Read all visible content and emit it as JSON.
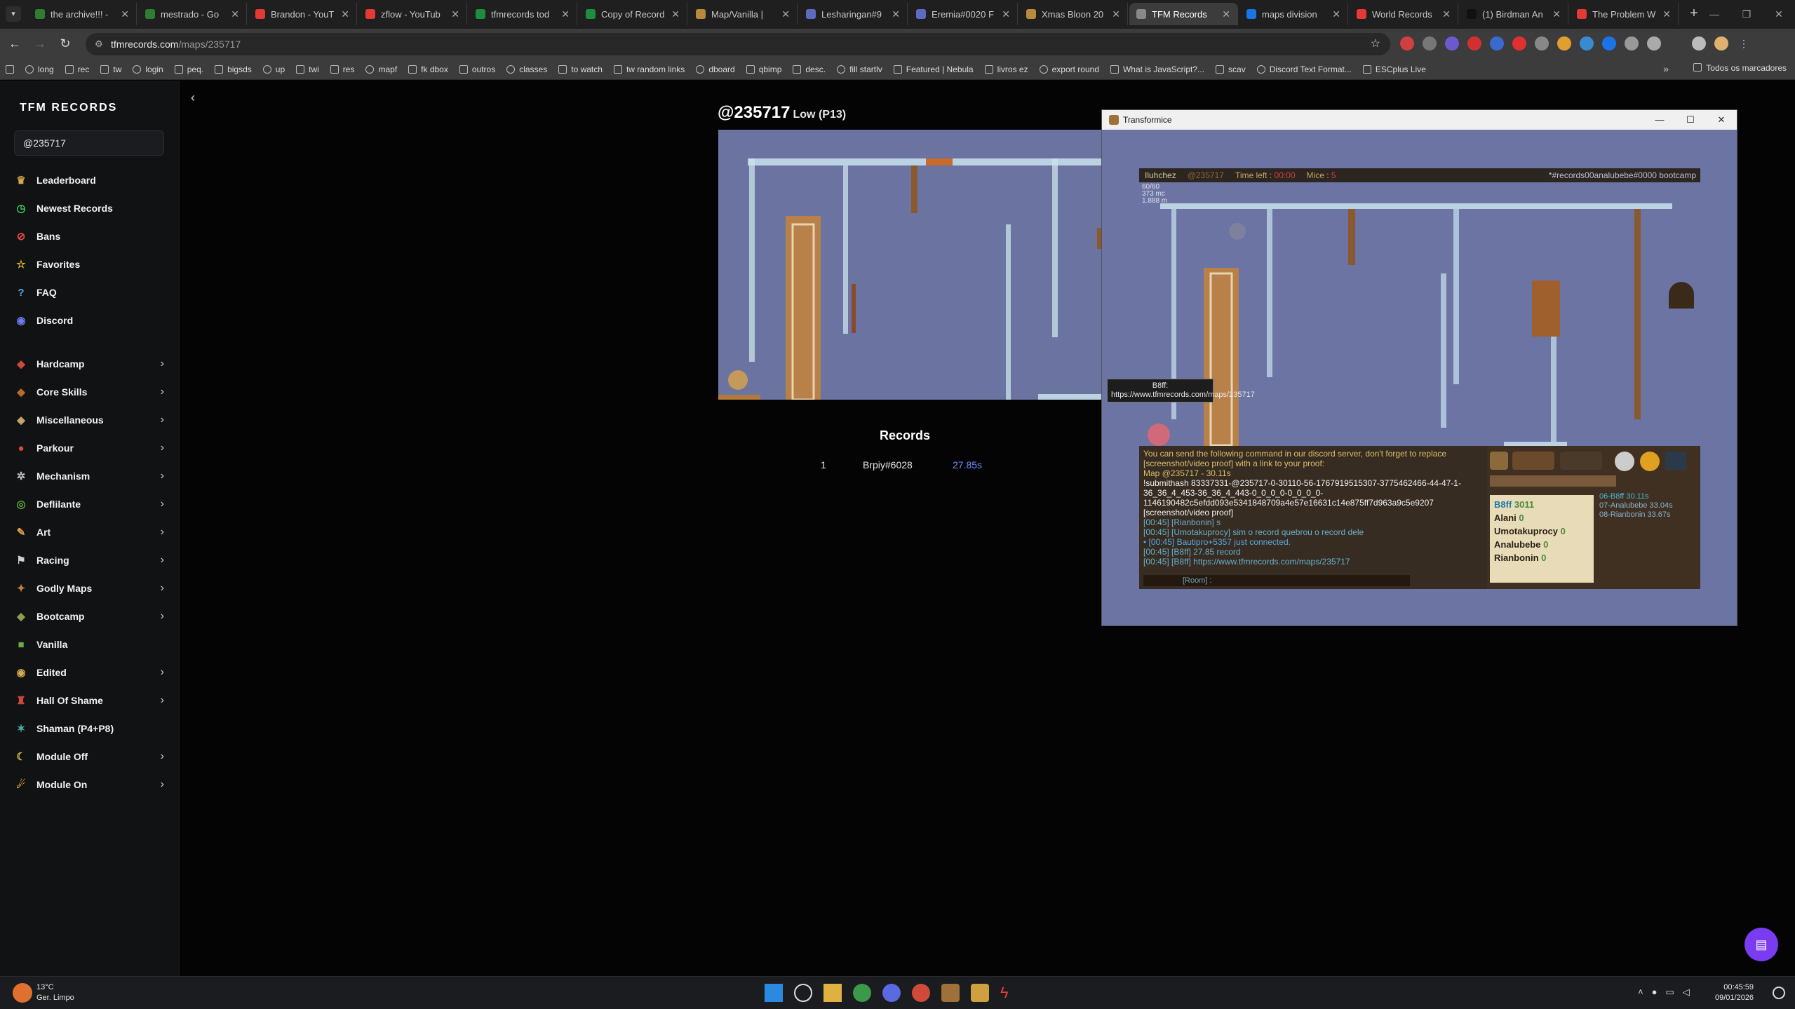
{
  "tabs": [
    {
      "title": "the archive!!! -",
      "color": "#2e7d32"
    },
    {
      "title": "mestrado - Go",
      "color": "#2e7d32"
    },
    {
      "title": "Brandon - YouT",
      "color": "#e53935"
    },
    {
      "title": "zflow - YouTub",
      "color": "#e53935"
    },
    {
      "title": "tfmrecords tod",
      "color": "#1e8e3e"
    },
    {
      "title": "Copy of Record",
      "color": "#1e8e3e"
    },
    {
      "title": "Map/Vanilla |",
      "color": "#b98a3d"
    },
    {
      "title": "Lesharingan#9",
      "color": "#5c6bc0"
    },
    {
      "title": "Eremia#0020 F",
      "color": "#5c6bc0"
    },
    {
      "title": "Xmas Bloon 20",
      "color": "#b98a3d"
    },
    {
      "title": "TFM Records",
      "color": "#888888",
      "active": true
    },
    {
      "title": "maps division",
      "color": "#1a73e8"
    },
    {
      "title": "World Records",
      "color": "#e53935"
    },
    {
      "title": "(1) Birdman An",
      "color": "#111111"
    },
    {
      "title": "The Problem W",
      "color": "#e53935"
    }
  ],
  "address": {
    "host": "tfmrecords.com",
    "path": "/maps/235717"
  },
  "bookmarks": [
    "long",
    "rec",
    "tw",
    "login",
    "peq.",
    "bigsds",
    "up",
    "twi",
    "res",
    "mapf",
    "fk dbox",
    "outros",
    "classes",
    "to watch",
    "tw random links",
    "dboard",
    "qbimp",
    "desc.",
    "fill startlv",
    "Featured | Nebula",
    "livros ez",
    "export round",
    "What is JavaScript?...",
    "scav",
    "Discord Text Format...",
    "ESCplus Live"
  ],
  "bookmarks_other": "Todos os marcadores",
  "sidebar": {
    "brand": "TFM RECORDS",
    "search_value": "@235717",
    "primary": [
      {
        "label": "Leaderboard",
        "icon": "crown-icon",
        "glyph": "♛",
        "color": "#d6a94a"
      },
      {
        "label": "Newest Records",
        "icon": "clock-icon",
        "glyph": "◷",
        "color": "#43c463"
      },
      {
        "label": "Bans",
        "icon": "ban-icon",
        "glyph": "⊘",
        "color": "#e84a4a"
      },
      {
        "label": "Favorites",
        "icon": "star-icon",
        "glyph": "☆",
        "color": "#e5c03a"
      },
      {
        "label": "FAQ",
        "icon": "question-icon",
        "glyph": "?",
        "color": "#5aa7e0"
      },
      {
        "label": "Discord",
        "icon": "discord-icon",
        "glyph": "◉",
        "color": "#6b7cf0"
      }
    ],
    "categories": [
      {
        "label": "Hardcamp",
        "icon": "hardcamp-icon",
        "glyph": "◆",
        "color": "#c94a3a",
        "chevron": true
      },
      {
        "label": "Core Skills",
        "icon": "core-skills-icon",
        "glyph": "◆",
        "color": "#b86a2a",
        "chevron": true
      },
      {
        "label": "Miscellaneous",
        "icon": "misc-icon",
        "glyph": "◆",
        "color": "#c7a26a",
        "chevron": true
      },
      {
        "label": "Parkour",
        "icon": "parkour-icon",
        "glyph": "●",
        "color": "#d84a3a",
        "chevron": true
      },
      {
        "label": "Mechanism",
        "icon": "gear-icon",
        "glyph": "✲",
        "color": "#bfbfbf",
        "chevron": true
      },
      {
        "label": "Deflilante",
        "icon": "defilante-icon",
        "glyph": "◎",
        "color": "#5ca83a",
        "chevron": true
      },
      {
        "label": "Art",
        "icon": "brush-icon",
        "glyph": "✎",
        "color": "#e0a24a",
        "chevron": true
      },
      {
        "label": "Racing",
        "icon": "racing-flag-icon",
        "glyph": "⚑",
        "color": "#d0d0d0",
        "chevron": true
      },
      {
        "label": "Godly Maps",
        "icon": "godly-icon",
        "glyph": "✦",
        "color": "#b8863a",
        "chevron": true
      },
      {
        "label": "Bootcamp",
        "icon": "bootcamp-icon",
        "glyph": "◆",
        "color": "#8aa04a",
        "chevron": true
      },
      {
        "label": "Vanilla",
        "icon": "vanilla-icon",
        "glyph": "■",
        "color": "#6aa84a",
        "chevron": false
      },
      {
        "label": "Edited",
        "icon": "edited-icon",
        "glyph": "◉",
        "color": "#d6a94a",
        "chevron": true
      },
      {
        "label": "Hall Of Shame",
        "icon": "shame-icon",
        "glyph": "♜",
        "color": "#d04a3a",
        "chevron": true
      },
      {
        "label": "Shaman (P4+P8)",
        "icon": "shaman-icon",
        "glyph": "✶",
        "color": "#4ab0a0",
        "chevron": false
      },
      {
        "label": "Module Off",
        "icon": "moon-icon",
        "glyph": "☾",
        "color": "#e0c04a",
        "chevron": true
      },
      {
        "label": "Module On",
        "icon": "module-on-icon",
        "glyph": "☄",
        "color": "#e0a03a",
        "chevron": true
      }
    ]
  },
  "map": {
    "code": "@235717",
    "difficulty": "Low (P13)"
  },
  "records": {
    "heading": "Records",
    "rows": [
      {
        "rank": "1",
        "player": "Brpiy#6028",
        "time": "27.85s"
      }
    ]
  },
  "tfm": {
    "window_title": "Transformice",
    "hud": {
      "player": "Iluhchez",
      "player_code": "@235717",
      "time_label": "Time left :",
      "time_value": "00:00",
      "mice_label": "Mice :",
      "mice_value": "5",
      "room": "*#records00analubebe#0000 bootcamp"
    },
    "stats": [
      "60/60",
      "373 mc",
      "1.888 m"
    ],
    "tooltip": "B8ff: https://www.tfmrecords.com/maps/235717",
    "chat": [
      {
        "cls": "sys",
        "text": "You can send the following command in our discord server, don't forget to replace [screenshot/video proof] with a link to your proof:"
      },
      {
        "cls": "sys",
        "text": "Map @235717 - 30.11s"
      },
      {
        "cls": "w",
        "text": "!submithash 83337331-@235717-0-30110-56-1767919515307-3775462466-44-47-1-36_36_4_453-36_36_4_443-0_0_0_0-0_0_0_0-1146190482c5efdd093e5341848709a4e57e16631c14e875ff7d963a9c5e9207 [screenshot/video proof]"
      },
      {
        "cls": "nm",
        "text": "[00:45] [Rianbonin] s"
      },
      {
        "cls": "nm",
        "text": "[00:45] [Umotakuprocy] sim o record quebrou o record dele"
      },
      {
        "cls": "join",
        "text": "• [00:45] Bautipro+5357 just connected."
      },
      {
        "cls": "nm",
        "text": "[00:45] [B8ff] 27.85 record"
      },
      {
        "cls": "nm",
        "text": "[00:45] [B8ff] https://www.tfmrecords.com/maps/235717"
      }
    ],
    "chat_input_placeholder": "[Room] :",
    "players": [
      {
        "name": "B8ff",
        "score": "3011",
        "me": true
      },
      {
        "name": "Alani",
        "score": "0"
      },
      {
        "name": "Umotakuprocy",
        "score": "0"
      },
      {
        "name": "Analubebe",
        "score": "0"
      },
      {
        "name": "Rianbonin",
        "score": "0"
      }
    ],
    "mini_records": [
      "06-B8ff 30.11s",
      "07-Analubebe 33.04s",
      "08-Rianbonin 33.67s"
    ]
  },
  "taskbar": {
    "temp": "13°C",
    "weather": "Ger. Limpo",
    "time": "00:45:59",
    "date": "09/01/2026"
  }
}
